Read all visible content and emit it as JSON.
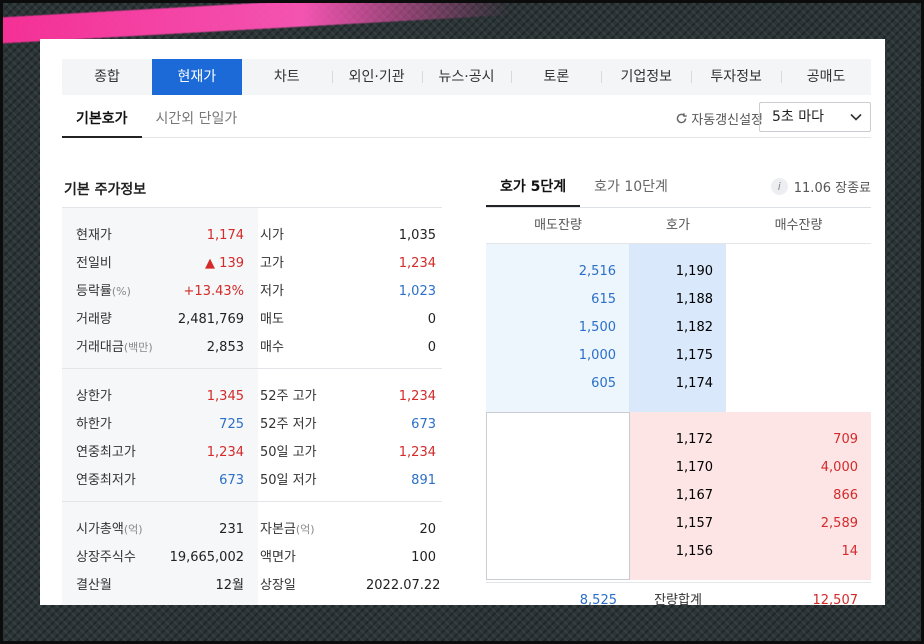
{
  "main_tabs": [
    "종합",
    "현재가",
    "차트",
    "외인·기관",
    "뉴스·공시",
    "토론",
    "기업정보",
    "투자정보",
    "공매도"
  ],
  "sub_tabs": [
    "기본호가",
    "시간외 단일가"
  ],
  "refresh_label": "자동갱신설정",
  "refresh_interval": "5초 마다",
  "left_title": "기본 주가정보",
  "left_rows_g1": [
    {
      "l1": "현재가",
      "l1s": "",
      "v1": "1,174",
      "c1": "red",
      "l2": "시가",
      "l2s": "",
      "v2": "1,035",
      "c2": ""
    },
    {
      "l1": "전일비",
      "l1s": "",
      "v1": "▲ 139",
      "c1": "red",
      "l2": "고가",
      "l2s": "",
      "v2": "1,234",
      "c2": "red"
    },
    {
      "l1": "등락률",
      "l1s": "(%)",
      "v1": "+13.43%",
      "c1": "red",
      "l2": "저가",
      "l2s": "",
      "v2": "1,023",
      "c2": "blue"
    },
    {
      "l1": "거래량",
      "l1s": "",
      "v1": "2,481,769",
      "c1": "",
      "l2": "매도",
      "l2s": "",
      "v2": "0",
      "c2": ""
    },
    {
      "l1": "거래대금",
      "l1s": "(백만)",
      "v1": "2,853",
      "c1": "",
      "l2": "매수",
      "l2s": "",
      "v2": "0",
      "c2": ""
    }
  ],
  "left_rows_g2": [
    {
      "l1": "상한가",
      "l1s": "",
      "v1": "1,345",
      "c1": "red",
      "l2": "52주 고가",
      "l2s": "",
      "v2": "1,234",
      "c2": "red"
    },
    {
      "l1": "하한가",
      "l1s": "",
      "v1": "725",
      "c1": "blue",
      "l2": "52주 저가",
      "l2s": "",
      "v2": "673",
      "c2": "blue"
    },
    {
      "l1": "연중최고가",
      "l1s": "",
      "v1": "1,234",
      "c1": "red",
      "l2": "50일 고가",
      "l2s": "",
      "v2": "1,234",
      "c2": "red"
    },
    {
      "l1": "연중최저가",
      "l1s": "",
      "v1": "673",
      "c1": "blue",
      "l2": "50일 저가",
      "l2s": "",
      "v2": "891",
      "c2": "blue"
    }
  ],
  "left_rows_g3": [
    {
      "l1": "시가총액",
      "l1s": "(억)",
      "v1": "231",
      "c1": "",
      "l2": "자본금",
      "l2s": "(억)",
      "v2": "20",
      "c2": ""
    },
    {
      "l1": "상장주식수",
      "l1s": "",
      "v1": "19,665,002",
      "c1": "",
      "l2": "액면가",
      "l2s": "",
      "v2": "100",
      "c2": ""
    },
    {
      "l1": "결산월",
      "l1s": "",
      "v1": "12월",
      "c1": "",
      "l2": "상장일",
      "l2s": "",
      "v2": "2022.07.22",
      "c2": ""
    }
  ],
  "orderbook": {
    "tabs": [
      "호가 5단계",
      "호가 10단계"
    ],
    "status": "11.06 장종료",
    "info_icon": "i",
    "headers": [
      "매도잔량",
      "호가",
      "매수잔량"
    ],
    "asks": [
      {
        "qty": "2,516",
        "price": "1,190"
      },
      {
        "qty": "615",
        "price": "1,188"
      },
      {
        "qty": "1,500",
        "price": "1,182"
      },
      {
        "qty": "1,000",
        "price": "1,175"
      },
      {
        "qty": "605",
        "price": "1,174"
      }
    ],
    "bids": [
      {
        "price": "1,172",
        "qty": "709"
      },
      {
        "price": "1,170",
        "qty": "4,000"
      },
      {
        "price": "1,167",
        "qty": "866"
      },
      {
        "price": "1,157",
        "qty": "2,589"
      },
      {
        "price": "1,156",
        "qty": "14"
      }
    ],
    "sum_ask": "8,525",
    "sum_label": "잔량합계",
    "sum_bid": "12,507"
  },
  "colors": {
    "accent": "#1b6ad8",
    "up": "#d42a2a",
    "down": "#2b6fc8"
  }
}
